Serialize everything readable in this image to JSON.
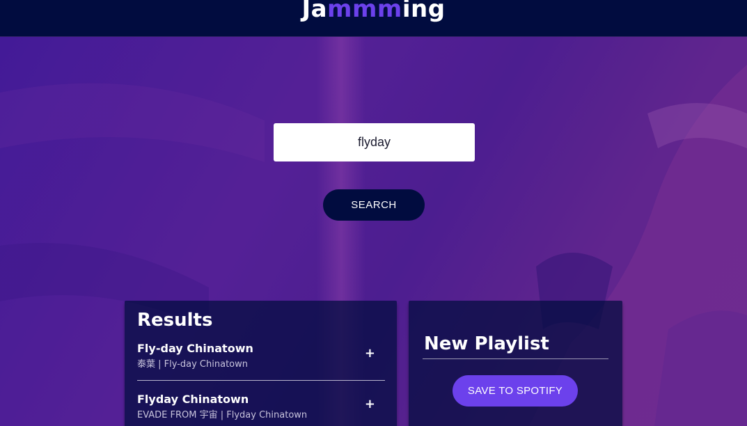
{
  "header": {
    "logo_prefix": "Ja",
    "logo_highlight": "mmm",
    "logo_suffix": "ing"
  },
  "search": {
    "value": "flyday",
    "button_label": "SEARCH"
  },
  "results": {
    "title": "Results",
    "tracks": [
      {
        "name": "Fly-day Chinatown",
        "info": "泰葉 | Fly-day Chinatown",
        "action": "+"
      },
      {
        "name": "Flyday Chinatown",
        "info": "EVADE FROM 宇宙 | Flyday Chinatown",
        "action": "+"
      }
    ]
  },
  "playlist": {
    "name_value": "New Playlist",
    "save_label": "SAVE TO SPOTIFY"
  },
  "colors": {
    "header_bg": "#010c3f",
    "accent": "#6c41ec",
    "panel_bg": "#010c3f",
    "background_purple": "#5a2399"
  }
}
